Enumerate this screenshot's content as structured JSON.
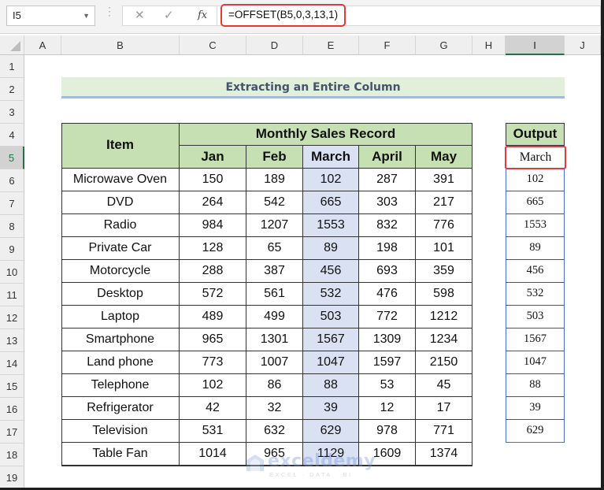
{
  "formula_bar": {
    "name_box": "I5",
    "cancel_icon": "close-icon",
    "enter_icon": "check-icon",
    "function_icon": "fx",
    "formula": "=OFFSET(B5,0,3,13,1)"
  },
  "columns": [
    "A",
    "B",
    "C",
    "D",
    "E",
    "F",
    "G",
    "H",
    "I",
    "J"
  ],
  "selected_column": "I",
  "rows": [
    "1",
    "2",
    "3",
    "4",
    "5",
    "6",
    "7",
    "8",
    "9",
    "10",
    "11",
    "12",
    "13",
    "14",
    "15",
    "16",
    "17",
    "18",
    "19"
  ],
  "selected_row": "5",
  "title": "Extracting an Entire Column",
  "table": {
    "item_header": "Item",
    "group_header": "Monthly Sales Record",
    "months": [
      "Jan",
      "Feb",
      "March",
      "April",
      "May"
    ],
    "highlighted_month": "March",
    "rows": [
      {
        "item": "Microwave Oven",
        "values": [
          "150",
          "189",
          "102",
          "287",
          "391"
        ]
      },
      {
        "item": "DVD",
        "values": [
          "264",
          "542",
          "665",
          "303",
          "217"
        ]
      },
      {
        "item": "Radio",
        "values": [
          "984",
          "1207",
          "1553",
          "832",
          "776"
        ]
      },
      {
        "item": "Private Car",
        "values": [
          "128",
          "65",
          "89",
          "198",
          "101"
        ]
      },
      {
        "item": "Motorcycle",
        "values": [
          "288",
          "387",
          "456",
          "693",
          "359"
        ]
      },
      {
        "item": "Desktop",
        "values": [
          "572",
          "561",
          "532",
          "476",
          "598"
        ]
      },
      {
        "item": "Laptop",
        "values": [
          "489",
          "499",
          "503",
          "772",
          "1212"
        ]
      },
      {
        "item": "Smartphone",
        "values": [
          "965",
          "1301",
          "1567",
          "1309",
          "1234"
        ]
      },
      {
        "item": "Land phone",
        "values": [
          "773",
          "1007",
          "1047",
          "1597",
          "2150"
        ]
      },
      {
        "item": "Telephone",
        "values": [
          "102",
          "86",
          "88",
          "53",
          "45"
        ]
      },
      {
        "item": "Refrigerator",
        "values": [
          "42",
          "32",
          "39",
          "12",
          "17"
        ]
      },
      {
        "item": "Television",
        "values": [
          "531",
          "632",
          "629",
          "978",
          "771"
        ]
      },
      {
        "item": "Table Fan",
        "values": [
          "1014",
          "965",
          "1129",
          "1609",
          "1374"
        ]
      }
    ]
  },
  "output": {
    "header": "Output",
    "first": "March",
    "values": [
      "102",
      "665",
      "1553",
      "89",
      "456",
      "532",
      "503",
      "1567",
      "1047",
      "88",
      "39",
      "629"
    ]
  },
  "watermark": {
    "name": "exceldemy",
    "tagline": "EXCEL · DATA · BI"
  },
  "colors": {
    "header_green": "#c6e0b4",
    "title_green": "#e2efda",
    "highlight_blue": "#d9e1f2",
    "selection_red": "#e03a3a",
    "excel_green": "#217346"
  }
}
